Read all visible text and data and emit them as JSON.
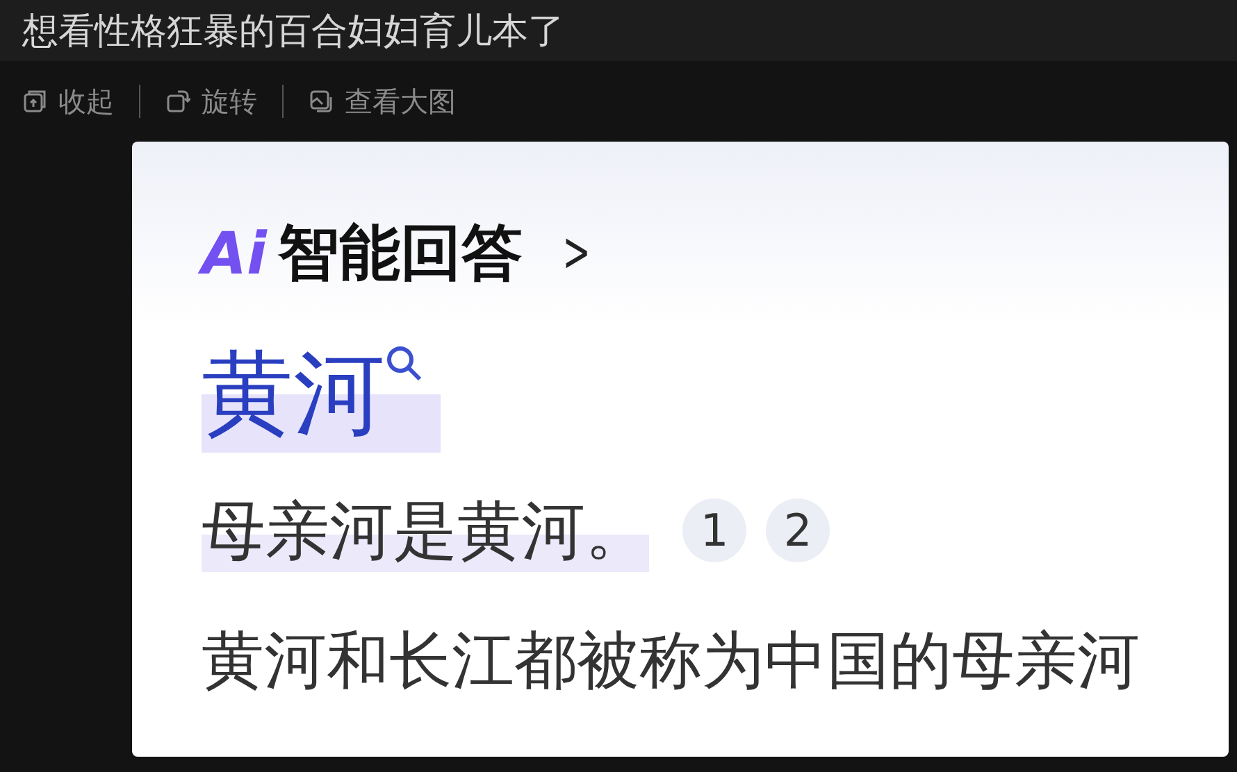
{
  "title": "想看性格狂暴的百合妇妇育儿本了",
  "toolbar": [
    {
      "kind": "collapse",
      "label": "收起"
    },
    {
      "kind": "rotate",
      "label": "旋转"
    },
    {
      "kind": "view",
      "label": "查看大图"
    }
  ],
  "image": {
    "brand": {
      "logo": "Ai",
      "label": "智能回答",
      "chevron": ">"
    },
    "heading": "黄河",
    "answer": "母亲河是黄河。",
    "citations": [
      "1",
      "2"
    ],
    "next_line": "黄河和长江都被称为中国的母亲河"
  }
}
